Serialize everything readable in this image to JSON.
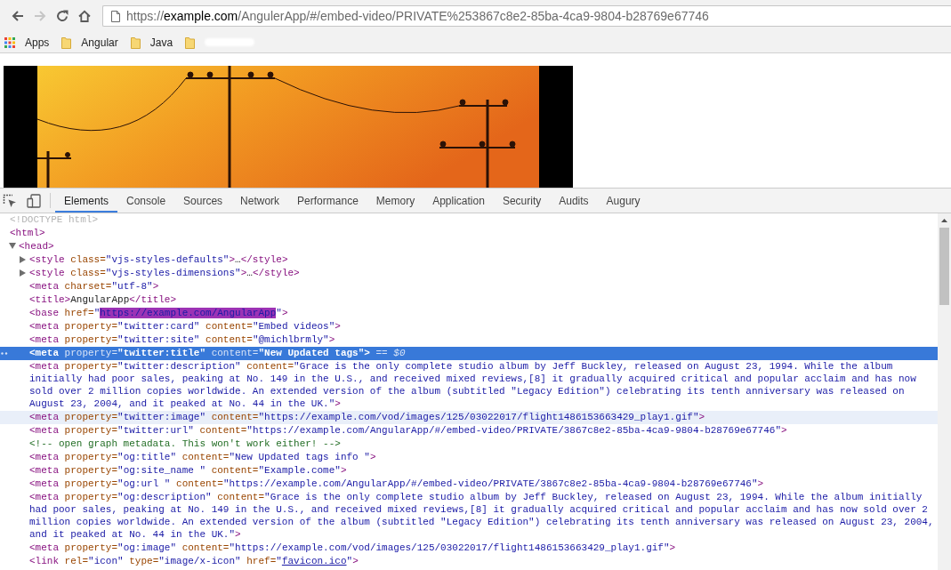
{
  "browser": {
    "nav_buttons": [
      {
        "kind": "back",
        "disabled": false
      },
      {
        "kind": "forward",
        "disabled": true
      },
      {
        "kind": "reload",
        "disabled": false
      },
      {
        "kind": "home",
        "disabled": false
      }
    ],
    "address_bar": {
      "url_parts": [
        {
          "text": "https://",
          "emphasized": false
        },
        {
          "text": "example.com",
          "emphasized": true
        },
        {
          "text": "/AngulerApp/#/embed-video/PRIVATE%253867c8e2-85ba-4ca9-9804-b28769e67746",
          "emphasized": false
        }
      ]
    },
    "bookmarks": [
      {
        "kind": "apps",
        "label": "Apps",
        "redacted": false
      },
      {
        "kind": "folder",
        "label": "Angular",
        "redacted": false
      },
      {
        "kind": "folder",
        "label": "Java",
        "redacted": false
      },
      {
        "kind": "folder",
        "redacted": true
      }
    ]
  },
  "devtools": {
    "tabs": [
      {
        "label": "Elements",
        "selected": true
      },
      {
        "label": "Console",
        "selected": false
      },
      {
        "label": "Sources",
        "selected": false
      },
      {
        "label": "Network",
        "selected": false
      },
      {
        "label": "Performance",
        "selected": false
      },
      {
        "label": "Memory",
        "selected": false
      },
      {
        "label": "Application",
        "selected": false
      },
      {
        "label": "Security",
        "selected": false
      },
      {
        "label": "Audits",
        "selected": false
      },
      {
        "label": "Augury",
        "selected": false
      }
    ],
    "dom_tree": [
      {
        "tokens": [
          {
            "kind": "doctype",
            "text": "<!DOCTYPE html>"
          }
        ],
        "selected": false,
        "hovered": false
      },
      {
        "tokens": [
          {
            "kind": "tag",
            "text": "<html>"
          }
        ],
        "selected": false,
        "hovered": false,
        "children": [
          {
            "tokens": [
              {
                "kind": "tag",
                "text": "<head>"
              }
            ],
            "selected": false,
            "hovered": false,
            "expanded": true,
            "children": [
              {
                "tokens": [
                  {
                    "kind": "tag",
                    "text": "<style"
                  },
                  {
                    "kind": "attr",
                    "text": " class="
                  },
                  {
                    "kind": "value",
                    "text": "\"vjs-styles-defaults\""
                  },
                  {
                    "kind": "tag",
                    "text": ">"
                  },
                  {
                    "kind": "text",
                    "text": "…"
                  },
                  {
                    "kind": "tag",
                    "text": "</style>"
                  }
                ],
                "selected": false,
                "hovered": false,
                "expanded": false
              },
              {
                "tokens": [
                  {
                    "kind": "tag",
                    "text": "<style"
                  },
                  {
                    "kind": "attr",
                    "text": " class="
                  },
                  {
                    "kind": "value",
                    "text": "\"vjs-styles-dimensions\""
                  },
                  {
                    "kind": "tag",
                    "text": ">"
                  },
                  {
                    "kind": "text",
                    "text": "…"
                  },
                  {
                    "kind": "tag",
                    "text": "</style>"
                  }
                ],
                "selected": false,
                "hovered": false,
                "expanded": false
              },
              {
                "tokens": [
                  {
                    "kind": "tag",
                    "text": "<meta"
                  },
                  {
                    "kind": "attr",
                    "text": " charset="
                  },
                  {
                    "kind": "value",
                    "text": "\"utf-8\""
                  },
                  {
                    "kind": "tag",
                    "text": ">"
                  }
                ],
                "selected": false,
                "hovered": false
              },
              {
                "tokens": [
                  {
                    "kind": "tag",
                    "text": "<title>"
                  },
                  {
                    "kind": "text",
                    "text": "AngularApp"
                  },
                  {
                    "kind": "tag",
                    "text": "</title>"
                  }
                ],
                "selected": false,
                "hovered": false
              },
              {
                "tokens": [
                  {
                    "kind": "tag",
                    "text": "<base"
                  },
                  {
                    "kind": "attr",
                    "text": " href="
                  },
                  {
                    "kind": "value",
                    "text": "\""
                  },
                  {
                    "kind": "value",
                    "text": "https://example.com/AngularApp",
                    "highlighted": true
                  },
                  {
                    "kind": "value",
                    "text": "\""
                  },
                  {
                    "kind": "tag",
                    "text": ">"
                  }
                ],
                "selected": false,
                "hovered": false
              },
              {
                "tokens": [
                  {
                    "kind": "tag",
                    "text": "<meta"
                  },
                  {
                    "kind": "attr",
                    "text": " property="
                  },
                  {
                    "kind": "value",
                    "text": "\"twitter:card\""
                  },
                  {
                    "kind": "attr",
                    "text": " content="
                  },
                  {
                    "kind": "value",
                    "text": "\"Embed videos\""
                  },
                  {
                    "kind": "tag",
                    "text": ">"
                  }
                ],
                "selected": false,
                "hovered": false
              },
              {
                "tokens": [
                  {
                    "kind": "tag",
                    "text": "<meta"
                  },
                  {
                    "kind": "attr",
                    "text": " property="
                  },
                  {
                    "kind": "value",
                    "text": "\"twitter:site\""
                  },
                  {
                    "kind": "attr",
                    "text": " content="
                  },
                  {
                    "kind": "value",
                    "text": "\"@michlbrmly\""
                  },
                  {
                    "kind": "tag",
                    "text": ">"
                  }
                ],
                "selected": false,
                "hovered": false
              },
              {
                "tokens": [
                  {
                    "kind": "tag",
                    "text": "<meta"
                  },
                  {
                    "kind": "attr",
                    "text": " property="
                  },
                  {
                    "kind": "value",
                    "text": "\"twitter:title\""
                  },
                  {
                    "kind": "attr",
                    "text": " content="
                  },
                  {
                    "kind": "value",
                    "text": "\"New Updated tags\""
                  },
                  {
                    "kind": "tag",
                    "text": ">"
                  },
                  {
                    "kind": "marker",
                    "text": " == $0"
                  }
                ],
                "selected": true,
                "hovered": false
              },
              {
                "tokens": [
                  {
                    "kind": "tag",
                    "text": "<meta"
                  },
                  {
                    "kind": "attr",
                    "text": " property="
                  },
                  {
                    "kind": "value",
                    "text": "\"twitter:description\""
                  },
                  {
                    "kind": "attr",
                    "text": " content="
                  },
                  {
                    "kind": "value",
                    "text": "\"Grace is the only complete studio album by Jeff Buckley, released on August 23, 1994. While the album initially had poor sales, peaking at No. 149 in the U.S., and received mixed reviews,[8] it gradually acquired critical and popular acclaim and has now sold over 2 million copies worldwide. An extended version of the album (subtitled \"Legacy Edition\") celebrating its tenth anniversary was released on August 23, 2004, and it peaked at No. 44 in the UK.\""
                  },
                  {
                    "kind": "tag",
                    "text": ">"
                  }
                ],
                "selected": false,
                "hovered": false
              },
              {
                "tokens": [
                  {
                    "kind": "tag",
                    "text": "<meta"
                  },
                  {
                    "kind": "attr",
                    "text": " property="
                  },
                  {
                    "kind": "value",
                    "text": "\"twitter:image\""
                  },
                  {
                    "kind": "attr",
                    "text": " content="
                  },
                  {
                    "kind": "value",
                    "text": "\"https://example.com/vod/images/125/03022017/flight1486153663429_play1.gif\""
                  },
                  {
                    "kind": "tag",
                    "text": ">"
                  }
                ],
                "selected": false,
                "hovered": true
              },
              {
                "tokens": [
                  {
                    "kind": "tag",
                    "text": "<meta"
                  },
                  {
                    "kind": "attr",
                    "text": " property="
                  },
                  {
                    "kind": "value",
                    "text": "\"twitter:url\""
                  },
                  {
                    "kind": "attr",
                    "text": " content="
                  },
                  {
                    "kind": "value",
                    "text": "\"https://example.com/AngularApp/#/embed-video/PRIVATE/3867c8e2-85ba-4ca9-9804-b28769e67746\""
                  },
                  {
                    "kind": "tag",
                    "text": ">"
                  }
                ],
                "selected": false,
                "hovered": false
              },
              {
                "tokens": [
                  {
                    "kind": "comment",
                    "text": "<!-- open graph metadata. This won't work either! -->"
                  }
                ],
                "selected": false,
                "hovered": false
              },
              {
                "tokens": [
                  {
                    "kind": "tag",
                    "text": "<meta"
                  },
                  {
                    "kind": "attr",
                    "text": " property="
                  },
                  {
                    "kind": "value",
                    "text": "\"og:title\""
                  },
                  {
                    "kind": "attr",
                    "text": " content="
                  },
                  {
                    "kind": "value",
                    "text": "\"New Updated tags info \""
                  },
                  {
                    "kind": "tag",
                    "text": ">"
                  }
                ],
                "selected": false,
                "hovered": false
              },
              {
                "tokens": [
                  {
                    "kind": "tag",
                    "text": "<meta"
                  },
                  {
                    "kind": "attr",
                    "text": " property="
                  },
                  {
                    "kind": "value",
                    "text": "\"og:site_name \""
                  },
                  {
                    "kind": "attr",
                    "text": " content="
                  },
                  {
                    "kind": "value",
                    "text": "\"Example.come\""
                  },
                  {
                    "kind": "tag",
                    "text": ">"
                  }
                ],
                "selected": false,
                "hovered": false
              },
              {
                "tokens": [
                  {
                    "kind": "tag",
                    "text": "<meta"
                  },
                  {
                    "kind": "attr",
                    "text": " property="
                  },
                  {
                    "kind": "value",
                    "text": "\"og:url \""
                  },
                  {
                    "kind": "attr",
                    "text": " content="
                  },
                  {
                    "kind": "value",
                    "text": "\"https://example.com/AngularApp/#/embed-video/PRIVATE/3867c8e2-85ba-4ca9-9804-b28769e67746\""
                  },
                  {
                    "kind": "tag",
                    "text": ">"
                  }
                ],
                "selected": false,
                "hovered": false
              },
              {
                "tokens": [
                  {
                    "kind": "tag",
                    "text": "<meta"
                  },
                  {
                    "kind": "attr",
                    "text": " property="
                  },
                  {
                    "kind": "value",
                    "text": "\"og:description\""
                  },
                  {
                    "kind": "attr",
                    "text": " content="
                  },
                  {
                    "kind": "value",
                    "text": "\"Grace is the only complete studio album by Jeff Buckley, released on August 23, 1994. While the album initially had poor sales, peaking at No. 149 in the U.S., and received mixed reviews,[8] it gradually acquired critical and popular acclaim and has now sold over 2 million copies worldwide. An extended version of the album (subtitled \"Legacy Edition\") celebrating its tenth anniversary was released on August 23, 2004, and it peaked at No. 44 in the UK.\""
                  },
                  {
                    "kind": "tag",
                    "text": ">"
                  }
                ],
                "selected": false,
                "hovered": false
              },
              {
                "tokens": [
                  {
                    "kind": "tag",
                    "text": "<meta"
                  },
                  {
                    "kind": "attr",
                    "text": " property="
                  },
                  {
                    "kind": "value",
                    "text": "\"og:image\""
                  },
                  {
                    "kind": "attr",
                    "text": " content="
                  },
                  {
                    "kind": "value",
                    "text": "\"https://example.com/vod/images/125/03022017/flight1486153663429_play1.gif\""
                  },
                  {
                    "kind": "tag",
                    "text": ">"
                  }
                ],
                "selected": false,
                "hovered": false
              },
              {
                "tokens": [
                  {
                    "kind": "tag",
                    "text": "<link"
                  },
                  {
                    "kind": "attr",
                    "text": " rel="
                  },
                  {
                    "kind": "value",
                    "text": "\"icon\""
                  },
                  {
                    "kind": "attr",
                    "text": " type="
                  },
                  {
                    "kind": "value",
                    "text": "\"image/x-icon\""
                  },
                  {
                    "kind": "attr",
                    "text": " href="
                  },
                  {
                    "kind": "value",
                    "text": "\""
                  },
                  {
                    "kind": "link",
                    "text": "favicon.ico"
                  },
                  {
                    "kind": "value",
                    "text": "\""
                  },
                  {
                    "kind": "tag",
                    "text": ">"
                  }
                ],
                "selected": false,
                "hovered": false
              }
            ]
          }
        ]
      }
    ]
  }
}
